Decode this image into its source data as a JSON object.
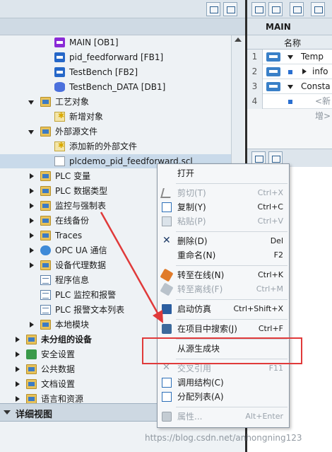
{
  "tree": {
    "items": [
      {
        "label": "MAIN [OB1]"
      },
      {
        "label": "pid_feedforward [FB1]"
      },
      {
        "label": "TestBench [FB2]"
      },
      {
        "label": "TestBench_DATA [DB1]"
      },
      {
        "label": "工艺对象"
      },
      {
        "label": "新增对象"
      },
      {
        "label": "外部源文件"
      },
      {
        "label": "添加新的外部文件"
      },
      {
        "label": "plcdemo_pid_feedforward.scl"
      },
      {
        "label": "PLC 变量"
      },
      {
        "label": "PLC 数据类型"
      },
      {
        "label": "监控与强制表"
      },
      {
        "label": "在线备份"
      },
      {
        "label": "Traces"
      },
      {
        "label": "OPC UA 通信"
      },
      {
        "label": "设备代理数据"
      },
      {
        "label": "程序信息"
      },
      {
        "label": "PLC 监控和报警"
      },
      {
        "label": "PLC 报警文本列表"
      },
      {
        "label": "本地模块"
      },
      {
        "label": "未分组的设备"
      },
      {
        "label": "安全设置"
      },
      {
        "label": "公共数据"
      },
      {
        "label": "文档设置"
      },
      {
        "label": "语言和资源"
      }
    ]
  },
  "detail_view": {
    "title": "详细视图"
  },
  "editor": {
    "title": "MAIN",
    "column_name": "名称",
    "rows": [
      {
        "num": "1",
        "text": "Temp"
      },
      {
        "num": "2",
        "text": "info"
      },
      {
        "num": "3",
        "text": "Consta"
      },
      {
        "num": "4",
        "text": "<新增>"
      }
    ]
  },
  "context_menu": {
    "open": "打开",
    "cut": {
      "label": "剪切(T)",
      "shortcut": "Ctrl+X"
    },
    "copy": {
      "label": "复制(Y)",
      "shortcut": "Ctrl+C"
    },
    "paste": {
      "label": "粘贴(P)",
      "shortcut": "Ctrl+V"
    },
    "delete": {
      "label": "删除(D)",
      "shortcut": "Del"
    },
    "rename": {
      "label": "重命名(N)",
      "shortcut": "F2"
    },
    "go_online": {
      "label": "转至在线(N)",
      "shortcut": "Ctrl+K"
    },
    "go_offline": {
      "label": "转至离线(F)",
      "shortcut": "Ctrl+M"
    },
    "start_sim": {
      "label": "启动仿真",
      "shortcut": "Ctrl+Shift+X"
    },
    "search_project": {
      "label": "在项目中搜索(J)",
      "shortcut": "Ctrl+F"
    },
    "generate_from_source": {
      "label": "从源生成块"
    },
    "cross_ref": {
      "label": "交叉引用",
      "shortcut": "F11"
    },
    "call_structure": {
      "label": "调用结构(C)"
    },
    "assignment_list": {
      "label": "分配列表(A)"
    },
    "properties": {
      "label": "属性...",
      "shortcut": "Alt+Enter"
    }
  },
  "watermark": "https://blog.csdn.net/anhongning123",
  "colors": {
    "highlight_box": "#e03a3a",
    "selection": "#c9daea"
  }
}
